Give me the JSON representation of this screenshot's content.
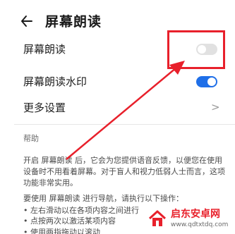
{
  "header": {
    "title": "屏幕朗读",
    "back_icon": "back-arrow-icon"
  },
  "settings": {
    "screen_reader": {
      "label": "屏幕朗读",
      "enabled": false
    },
    "watermark": {
      "label": "屏幕朗读水印",
      "enabled": true
    },
    "more": {
      "label": "更多设置",
      "chevron": ">"
    }
  },
  "help": {
    "title": "帮助",
    "paragraph": "开启 屏幕朗读 后，它会为您提供语音反馈，以便您在使用设备时不用看着屏幕。对于盲人和视力低弱人士而言，这项功能非常实用。",
    "intro": "要使用 屏幕朗读 进行导航，请执行以下操作：",
    "bullets": [
      "• 左右滑动以在各项内容之间进行",
      "• 点按两次以激活某项内容",
      "• 使用两指拖动以滚动"
    ]
  },
  "watermark_badge": {
    "name": "启东安卓网",
    "url": "www.qdtxtdq.com"
  },
  "colors": {
    "accent_blue": "#1f6fe8",
    "annotation_red": "#e8202b",
    "toggle_off": "#e1e1e1"
  }
}
